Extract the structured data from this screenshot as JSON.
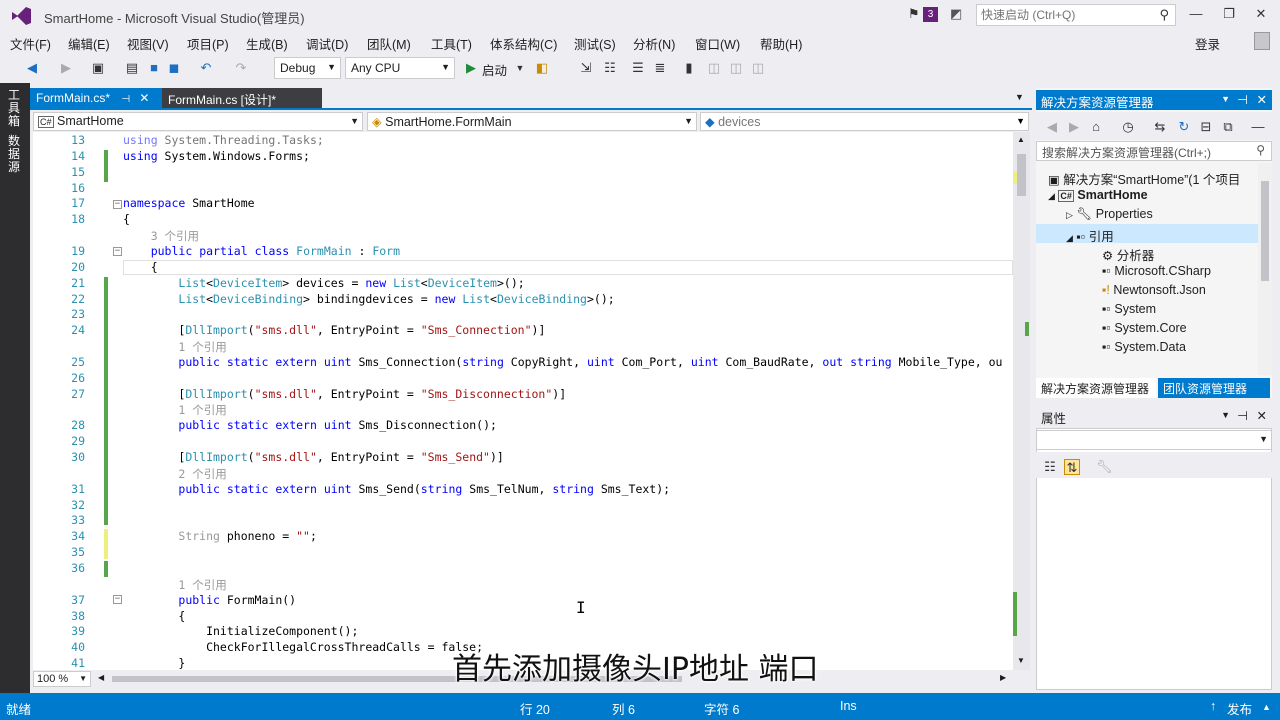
{
  "window": {
    "title": "SmartHome - Microsoft Visual Studio(管理员)",
    "notification_count": "3",
    "quick_launch_placeholder": "快速启动 (Ctrl+Q)"
  },
  "menu": [
    "文件(F)",
    "编辑(E)",
    "视图(V)",
    "项目(P)",
    "生成(B)",
    "调试(D)",
    "团队(M)",
    "工具(T)",
    "体系结构(C)",
    "测试(S)",
    "分析(N)",
    "窗口(W)",
    "帮助(H)"
  ],
  "login": "登录",
  "toolbar": {
    "config": "Debug",
    "platform": "Any CPU",
    "start": "启动"
  },
  "left_strip": {
    "toolbox": "工具箱",
    "datasource": "数据源"
  },
  "tabs": [
    {
      "label": "FormMain.cs*",
      "pin": "⊣",
      "close": "✕"
    },
    {
      "label": "FormMain.cs [设计]*"
    }
  ],
  "nav": {
    "project": "SmartHome",
    "class": "SmartHome.FormMain",
    "member": "devices"
  },
  "code": [
    {
      "n": "13",
      "t": "using System.Threading.Tasks;"
    },
    {
      "n": "14",
      "t": "using System.Windows.Forms;"
    },
    {
      "n": "15",
      "t": ""
    },
    {
      "n": "16",
      "t": ""
    },
    {
      "n": "17",
      "t": "namespace SmartHome"
    },
    {
      "n": "18",
      "t": "{"
    },
    {
      "n": "",
      "t": "    3 个引用"
    },
    {
      "n": "19",
      "t": "    public partial class FormMain : Form"
    },
    {
      "n": "20",
      "t": "    {"
    },
    {
      "n": "21",
      "t": "        List<DeviceItem> devices = new List<DeviceItem>();"
    },
    {
      "n": "22",
      "t": "        List<DeviceBinding> bindingdevices = new List<DeviceBinding>();"
    },
    {
      "n": "23",
      "t": ""
    },
    {
      "n": "24",
      "t": "        [DllImport(\"sms.dll\", EntryPoint = \"Sms_Connection\")]"
    },
    {
      "n": "",
      "t": "        1 个引用"
    },
    {
      "n": "25",
      "t": "        public static extern uint Sms_Connection(string CopyRight, uint Com_Port, uint Com_BaudRate, out string Mobile_Type, ou"
    },
    {
      "n": "26",
      "t": ""
    },
    {
      "n": "27",
      "t": "        [DllImport(\"sms.dll\", EntryPoint = \"Sms_Disconnection\")]"
    },
    {
      "n": "",
      "t": "        1 个引用"
    },
    {
      "n": "28",
      "t": "        public static extern uint Sms_Disconnection();"
    },
    {
      "n": "29",
      "t": ""
    },
    {
      "n": "30",
      "t": "        [DllImport(\"sms.dll\", EntryPoint = \"Sms_Send\")]"
    },
    {
      "n": "",
      "t": "        2 个引用"
    },
    {
      "n": "31",
      "t": "        public static extern uint Sms_Send(string Sms_TelNum, string Sms_Text);"
    },
    {
      "n": "32",
      "t": ""
    },
    {
      "n": "33",
      "t": ""
    },
    {
      "n": "34",
      "t": "        String phoneno = \"\";"
    },
    {
      "n": "35",
      "t": ""
    },
    {
      "n": "36",
      "t": ""
    },
    {
      "n": "",
      "t": "        1 个引用"
    },
    {
      "n": "37",
      "t": "        public FormMain()"
    },
    {
      "n": "38",
      "t": "        {"
    },
    {
      "n": "39",
      "t": "            InitializeComponent();"
    },
    {
      "n": "40",
      "t": "            CheckForIllegalCrossThreadCalls = false;"
    },
    {
      "n": "41",
      "t": "        }"
    }
  ],
  "zoom": "100 %",
  "solution_explorer": {
    "title": "解决方案资源管理器",
    "search_placeholder": "搜索解决方案资源管理器(Ctrl+;)",
    "items": [
      {
        "label": "解决方案“SmartHome”(1 个项目",
        "icon": "solution-icon"
      },
      {
        "label": "SmartHome",
        "icon": "csharp-project-icon"
      },
      {
        "label": "Properties",
        "icon": "wrench-icon"
      },
      {
        "label": "引用",
        "icon": "references-icon"
      },
      {
        "label": "分析器",
        "icon": "analyzer-icon"
      },
      {
        "label": "Microsoft.CSharp",
        "icon": "reference-icon"
      },
      {
        "label": "Newtonsoft.Json",
        "icon": "reference-warning-icon"
      },
      {
        "label": "System",
        "icon": "reference-icon"
      },
      {
        "label": "System.Core",
        "icon": "reference-icon"
      },
      {
        "label": "System.Data",
        "icon": "reference-icon"
      }
    ],
    "tabs": [
      "解决方案资源管理器",
      "团队资源管理器"
    ]
  },
  "properties": {
    "title": "属性"
  },
  "status": {
    "ready": "就绪",
    "line": "行 20",
    "col": "列 6",
    "char": "字符 6",
    "ins": "Ins",
    "publish": "发布"
  },
  "subtitle": "首先添加摄像头IP地址  端口",
  "colors": {
    "accent": "#007acc",
    "keyword": "#0000ff",
    "type": "#2b91af",
    "string": "#a31515"
  }
}
